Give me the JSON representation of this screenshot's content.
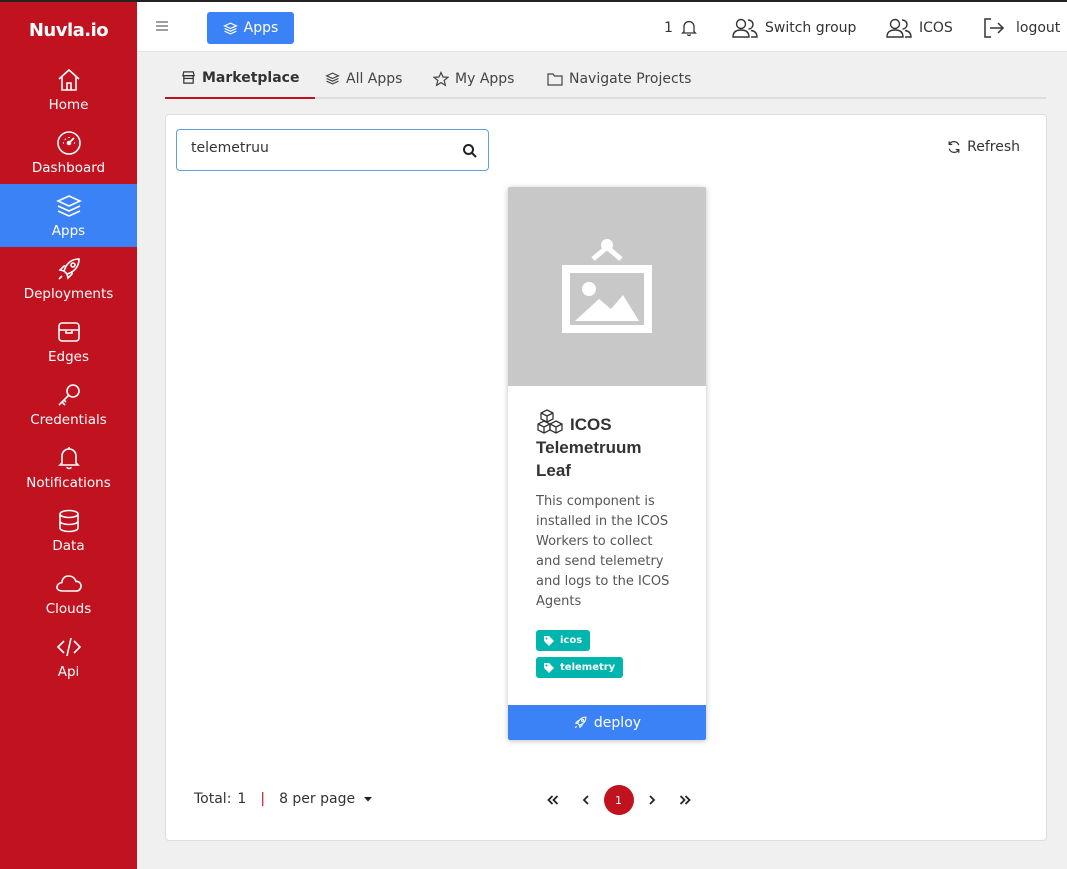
{
  "brand": {
    "logo": "Nuvla.io",
    "accent": "#c1121f",
    "active_blue": "#3b82f6"
  },
  "sidebar": {
    "items": [
      {
        "label": "Home",
        "icon": "home-icon"
      },
      {
        "label": "Dashboard",
        "icon": "gauge-icon"
      },
      {
        "label": "Apps",
        "icon": "layers-icon",
        "active": true
      },
      {
        "label": "Deployments",
        "icon": "rocket-icon"
      },
      {
        "label": "Edges",
        "icon": "box-icon"
      },
      {
        "label": "Credentials",
        "icon": "key-icon"
      },
      {
        "label": "Notifications",
        "icon": "bell-icon"
      },
      {
        "label": "Data",
        "icon": "database-icon"
      },
      {
        "label": "Clouds",
        "icon": "cloud-icon"
      },
      {
        "label": "Api",
        "icon": "code-icon"
      }
    ]
  },
  "topbar": {
    "apps_label": "Apps",
    "notification_count": "1",
    "switch_group_label": "Switch group",
    "group_name": "ICOS",
    "logout_label": "logout"
  },
  "tabs": [
    {
      "label": "Marketplace",
      "active": true
    },
    {
      "label": "All Apps"
    },
    {
      "label": "My Apps"
    },
    {
      "label": "Navigate Projects"
    }
  ],
  "search": {
    "value": "telemetruu"
  },
  "refresh_label": "Refresh",
  "card": {
    "title": "ICOS Telemetruum Leaf",
    "description": "This component is installed in the ICOS Workers to collect and send telemetry and logs to the ICOS Agents",
    "tags": [
      "icos",
      "telemetry"
    ],
    "deploy_label": "deploy"
  },
  "footer": {
    "total_label": "Total:",
    "total_value": "1",
    "separator": "|",
    "per_page": "8 per page",
    "current_page": "1"
  }
}
